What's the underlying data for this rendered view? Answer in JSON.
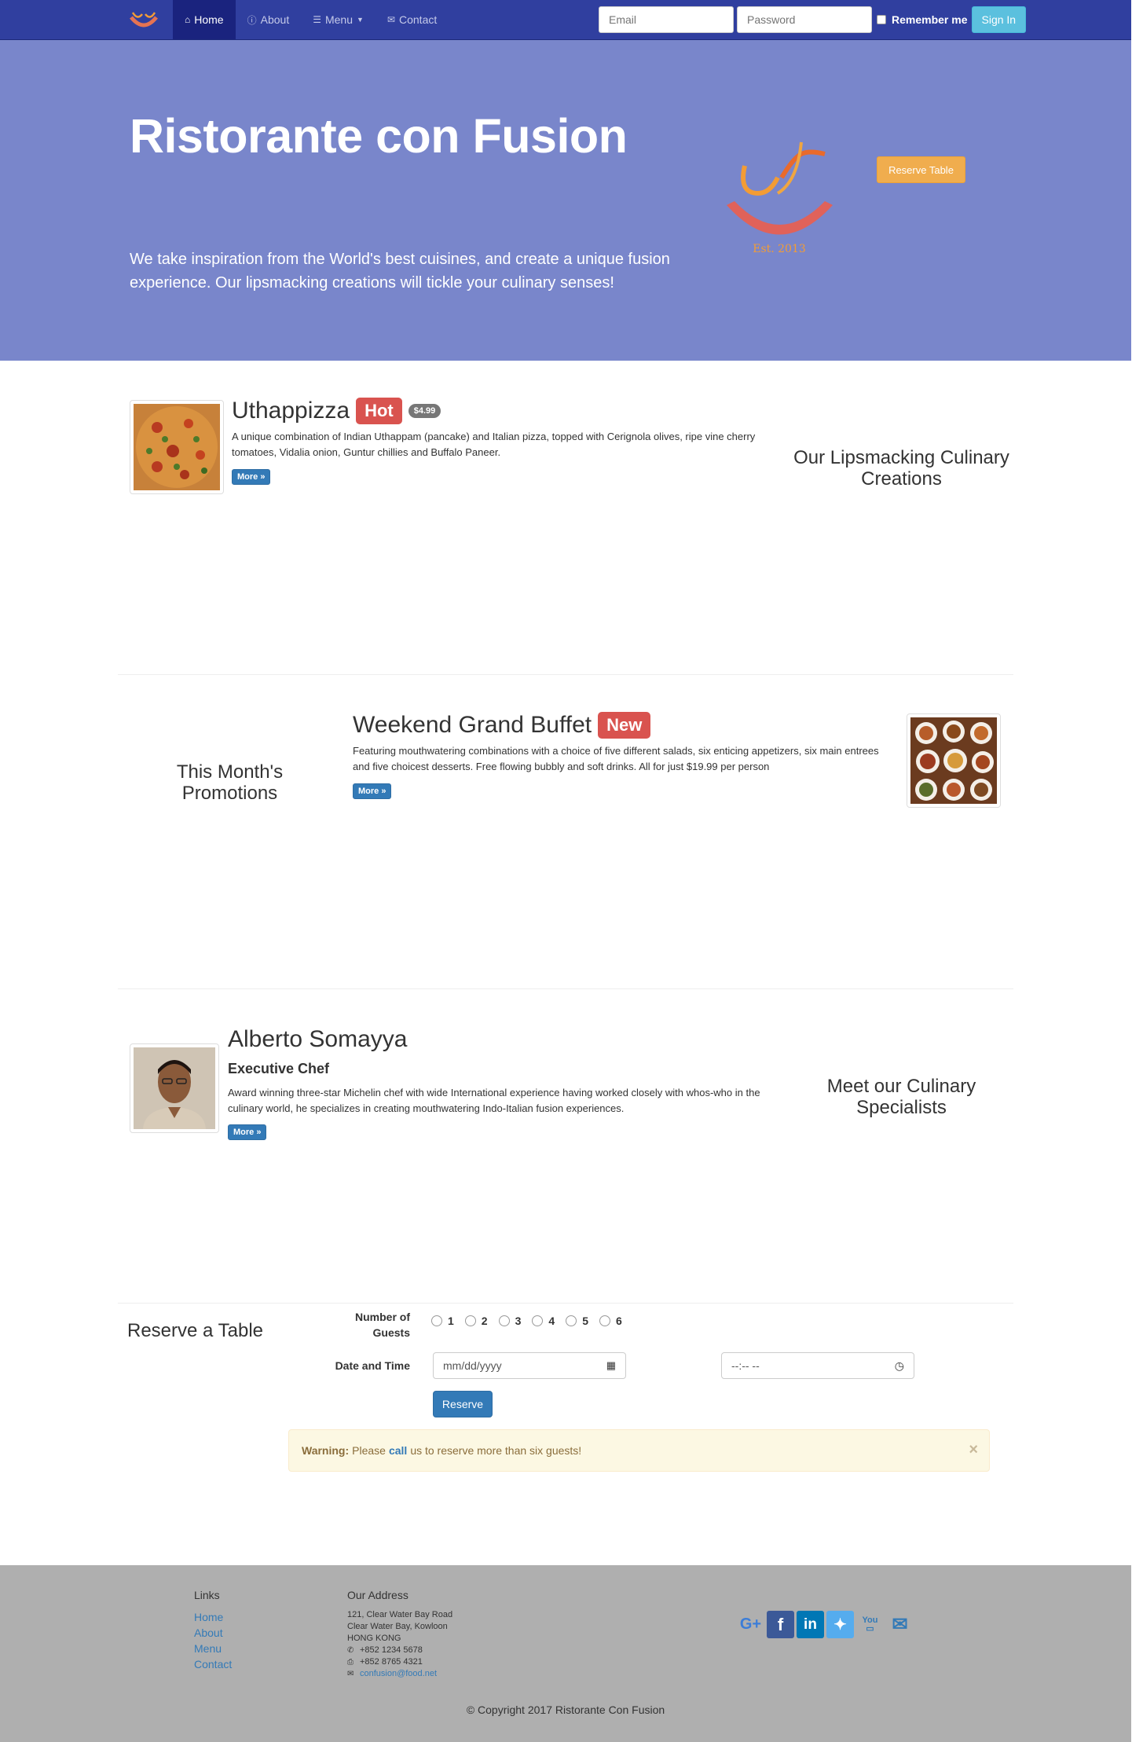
{
  "nav": {
    "items": [
      {
        "label": "Home",
        "icon": "home-icon",
        "active": true
      },
      {
        "label": "About",
        "icon": "info-icon"
      },
      {
        "label": "Menu",
        "icon": "list-icon",
        "caret": true
      },
      {
        "label": "Contact",
        "icon": "envelope-icon"
      }
    ],
    "email_placeholder": "Email",
    "password_placeholder": "Password",
    "remember_label": "Remember me",
    "signin_label": "Sign In"
  },
  "jumbotron": {
    "title": "Ristorante con Fusion",
    "text": "We take inspiration from the World's best cuisines, and create a unique fusion experience. Our lipsmacking creations will tickle your culinary senses!",
    "logo_text": "Ristorante con Fusion",
    "logo_est": "Est. 2013",
    "reserve_label": "Reserve Table"
  },
  "dish": {
    "name": "Uthappizza",
    "label": "Hot",
    "price": "$4.99",
    "description": "A unique combination of Indian Uthappam (pancake) and Italian pizza, topped with Cerignola olives, ripe vine cherry tomatoes, Vidalia onion, Guntur chillies and Buffalo Paneer.",
    "more": "More »",
    "side_heading": "Our Lipsmacking Culinary Creations"
  },
  "promotion": {
    "name": "Weekend Grand Buffet",
    "label": "New",
    "description": "Featuring mouthwatering combinations with a choice of five different salads, six enticing appetizers, six main entrees and five choicest desserts. Free flowing bubbly and soft drinks. All for just $19.99 per person",
    "more": "More »",
    "side_heading": "This Month's Promotions"
  },
  "leader": {
    "name": "Alberto Somayya",
    "designation": "Executive Chef",
    "description": "Award winning three-star Michelin chef with wide International experience having worked closely with whos-who in the culinary world, he specializes in creating mouthwatering Indo-Italian fusion experiences.",
    "more": "More »",
    "side_heading": "Meet our Culinary Specialists"
  },
  "reservation": {
    "title": "Reserve a Table",
    "guests_label": "Number of Guests",
    "guest_options": [
      "1",
      "2",
      "3",
      "4",
      "5",
      "6"
    ],
    "datetime_label": "Date and Time",
    "date_placeholder": "mm/dd/yyyy",
    "time_placeholder": "--:-- --",
    "submit_label": "Reserve",
    "warning_strong": "Warning:",
    "warning_pre": "Please",
    "warning_link": "call",
    "warning_post": "us to reserve more than six guests!",
    "close_glyph": "×"
  },
  "footer": {
    "links_heading": "Links",
    "links": [
      "Home",
      "About",
      "Menu",
      "Contact"
    ],
    "address_heading": "Our Address",
    "address_lines": [
      "121, Clear Water Bay Road",
      "Clear Water Bay, Kowloon",
      "HONG KONG"
    ],
    "phone": "+852 1234 5678",
    "fax": "+852 8765 4321",
    "email": "confusion@food.net",
    "social": [
      "google-plus-icon",
      "facebook-icon",
      "linkedin-icon",
      "twitter-icon",
      "youtube-icon",
      "mail-icon"
    ],
    "copyright": "© Copyright 2017 Ristorante Con Fusion"
  }
}
